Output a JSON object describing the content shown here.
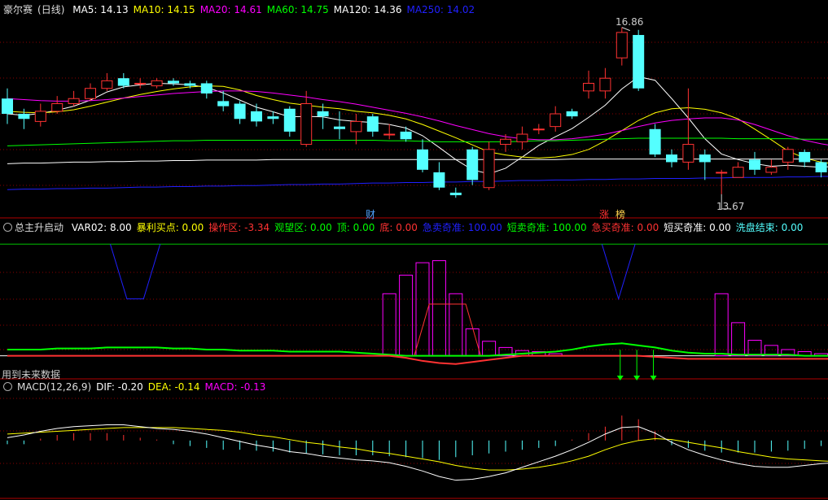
{
  "colors": {
    "up": "#ff3232",
    "down": "#54ffff",
    "ma5": "#ffffff",
    "ma10": "#ffff00",
    "ma20": "#ff00ff",
    "ma60": "#00ff00",
    "ma120": "#ffffff",
    "ma250": "#2020ff",
    "frame": "#b00000",
    "grid": "#8b0000"
  },
  "main_panel": {
    "stock_name": "豪尔赛",
    "period": "(日线)",
    "indicators": [
      {
        "label": "MA5: 14.13",
        "color": "#ffffff"
      },
      {
        "label": "MA10: 14.15",
        "color": "#ffff00"
      },
      {
        "label": "MA20: 14.61",
        "color": "#ff00ff"
      },
      {
        "label": "MA60: 14.75",
        "color": "#00ff00"
      },
      {
        "label": "MA120: 14.36",
        "color": "#ffffff"
      },
      {
        "label": "MA250: 14.02",
        "color": "#2020ff"
      }
    ],
    "high_label": "16.86",
    "low_label": "13.67",
    "event_tags": [
      {
        "text": "财",
        "color": "#4da3ff"
      },
      {
        "text": "涨",
        "color": "#ff3232"
      },
      {
        "text": "榜",
        "color": "#ffd24d"
      }
    ]
  },
  "indicator_panel": {
    "name": "总主升启动",
    "items": [
      {
        "label": "VAR02: 8.00",
        "color": "#ffffff"
      },
      {
        "label": "暴利买点: 0.00",
        "color": "#ffff00"
      },
      {
        "label": "操作区: -3.34",
        "color": "#ff3232"
      },
      {
        "label": "观望区: 0.00",
        "color": "#00ff00"
      },
      {
        "label": "顶: 0.00",
        "color": "#00ff00"
      },
      {
        "label": "底: 0.00",
        "color": "#ff3232"
      },
      {
        "label": "急卖奇准: 100.00",
        "color": "#2020ff"
      },
      {
        "label": "短卖奇准: 100.00",
        "color": "#00ff00"
      },
      {
        "label": "急买奇准: 0.00",
        "color": "#ff3232"
      },
      {
        "label": "短买奇准: 0.00",
        "color": "#ffffff"
      },
      {
        "label": "洗盘结束: 0.00",
        "color": "#54ffff"
      }
    ],
    "footer_note": "用到未来数据"
  },
  "macd_panel": {
    "items": [
      {
        "label": "MACD(12,26,9)",
        "color": "#dddddd"
      },
      {
        "label": "DIF: -0.20",
        "color": "#ffffff"
      },
      {
        "label": "DEA: -0.14",
        "color": "#ffff00"
      },
      {
        "label": "MACD: -0.13",
        "color": "#ff00ff"
      }
    ]
  },
  "chart_data": [
    {
      "type": "candlestick",
      "title": "豪尔赛(日线)",
      "ylim": [
        13.3,
        17.2
      ],
      "candles": [
        [
          15.55,
          15.25,
          15.75,
          15.05
        ],
        [
          15.25,
          15.15,
          15.35,
          14.95
        ],
        [
          15.1,
          15.3,
          15.45,
          15.0
        ],
        [
          15.3,
          15.45,
          15.6,
          15.25
        ],
        [
          15.45,
          15.55,
          15.7,
          15.4
        ],
        [
          15.55,
          15.75,
          15.85,
          15.5
        ],
        [
          15.75,
          15.9,
          16.05,
          15.7
        ],
        [
          15.95,
          15.8,
          16.05,
          15.75
        ],
        [
          15.85,
          15.85,
          15.95,
          15.75
        ],
        [
          15.8,
          15.9,
          15.95,
          15.75
        ],
        [
          15.9,
          15.85,
          15.95,
          15.8
        ],
        [
          15.85,
          15.8,
          15.9,
          15.75
        ],
        [
          15.85,
          15.65,
          15.9,
          15.55
        ],
        [
          15.5,
          15.4,
          15.7,
          15.3
        ],
        [
          15.45,
          15.15,
          15.5,
          15.05
        ],
        [
          15.3,
          15.1,
          15.45,
          15.0
        ],
        [
          15.2,
          15.15,
          15.3,
          15.05
        ],
        [
          15.35,
          14.9,
          15.4,
          14.8
        ],
        [
          14.65,
          15.45,
          15.7,
          14.6
        ],
        [
          15.3,
          15.2,
          15.45,
          14.95
        ],
        [
          15.0,
          14.95,
          15.3,
          14.75
        ],
        [
          14.9,
          15.1,
          15.25,
          14.65
        ],
        [
          15.2,
          14.9,
          15.25,
          14.8
        ],
        [
          14.85,
          14.85,
          15.05,
          14.75
        ],
        [
          14.9,
          14.75,
          15.0,
          14.7
        ],
        [
          14.55,
          14.15,
          14.75,
          14.1
        ],
        [
          14.1,
          13.8,
          14.3,
          13.75
        ],
        [
          13.7,
          13.65,
          13.8,
          13.6
        ],
        [
          14.55,
          13.95,
          14.6,
          13.85
        ],
        [
          13.8,
          14.55,
          14.7,
          13.75
        ],
        [
          14.65,
          14.75,
          14.85,
          14.5
        ],
        [
          14.7,
          14.85,
          15.0,
          14.55
        ],
        [
          14.95,
          14.95,
          15.05,
          14.85
        ],
        [
          15.0,
          15.25,
          15.4,
          14.9
        ],
        [
          15.3,
          15.2,
          15.35,
          15.15
        ],
        [
          15.7,
          15.85,
          16.1,
          15.55
        ],
        [
          15.7,
          15.95,
          16.15,
          15.55
        ],
        [
          16.35,
          16.85,
          16.95,
          16.2
        ],
        [
          16.8,
          15.75,
          16.9,
          15.7
        ],
        [
          14.95,
          14.45,
          15.05,
          14.4
        ],
        [
          14.45,
          14.3,
          14.55,
          14.2
        ],
        [
          14.3,
          14.65,
          15.75,
          14.15
        ],
        [
          14.45,
          14.3,
          14.55,
          13.95
        ],
        [
          14.1,
          14.1,
          14.15,
          13.67
        ],
        [
          14.0,
          14.2,
          14.3,
          14.0
        ],
        [
          14.35,
          14.15,
          14.5,
          14.05
        ],
        [
          14.1,
          14.2,
          14.35,
          14.05
        ],
        [
          14.3,
          14.55,
          14.6,
          14.15
        ],
        [
          14.5,
          14.3,
          14.55,
          14.2
        ],
        [
          14.3,
          14.1,
          14.35,
          14.0
        ],
        [
          14.05,
          14.15,
          14.25,
          13.95
        ]
      ],
      "ma_lines": [
        {
          "name": "MA5",
          "values": [
            15.25,
            15.22,
            15.26,
            15.32,
            15.4,
            15.52,
            15.68,
            15.78,
            15.82,
            15.85,
            15.84,
            15.82,
            15.77,
            15.66,
            15.52,
            15.38,
            15.29,
            15.19,
            15.2,
            15.19,
            15.13,
            15.1,
            15.08,
            15.04,
            14.97,
            14.82,
            14.59,
            14.35,
            14.15,
            14.07,
            14.18,
            14.4,
            14.63,
            14.8,
            14.96,
            15.18,
            15.42,
            15.74,
            15.98,
            15.91,
            15.55,
            15.17,
            14.76,
            14.46,
            14.35,
            14.27,
            14.22,
            14.24,
            14.22,
            14.2,
            14.22
          ]
        },
        {
          "name": "MA10",
          "values": [
            15.3,
            15.28,
            15.27,
            15.29,
            15.33,
            15.4,
            15.48,
            15.56,
            15.63,
            15.69,
            15.74,
            15.78,
            15.8,
            15.79,
            15.72,
            15.61,
            15.53,
            15.46,
            15.42,
            15.38,
            15.35,
            15.3,
            15.27,
            15.22,
            15.15,
            15.04,
            14.91,
            14.78,
            14.64,
            14.5,
            14.44,
            14.4,
            14.38,
            14.4,
            14.45,
            14.55,
            14.72,
            14.92,
            15.12,
            15.27,
            15.35,
            15.37,
            15.34,
            15.27,
            15.15,
            14.95,
            14.74,
            14.52,
            14.38,
            14.3,
            14.26
          ]
        },
        {
          "name": "MA20",
          "values": [
            15.55,
            15.53,
            15.51,
            15.5,
            15.5,
            15.51,
            15.53,
            15.56,
            15.59,
            15.62,
            15.65,
            15.67,
            15.69,
            15.7,
            15.7,
            15.69,
            15.66,
            15.62,
            15.58,
            15.53,
            15.49,
            15.44,
            15.38,
            15.32,
            15.26,
            15.19,
            15.11,
            15.02,
            14.94,
            14.86,
            14.8,
            14.76,
            14.74,
            14.74,
            14.76,
            14.8,
            14.85,
            14.92,
            15.0,
            15.07,
            15.12,
            15.15,
            15.17,
            15.17,
            15.13,
            15.04,
            14.93,
            14.82,
            14.73,
            14.66,
            14.61
          ]
        },
        {
          "name": "MA60",
          "values": [
            14.62,
            14.63,
            14.64,
            14.65,
            14.66,
            14.67,
            14.68,
            14.69,
            14.7,
            14.71,
            14.72,
            14.72,
            14.73,
            14.73,
            14.73,
            14.73,
            14.73,
            14.73,
            14.73,
            14.73,
            14.73,
            14.73,
            14.73,
            14.72,
            14.72,
            14.71,
            14.7,
            14.7,
            14.7,
            14.7,
            14.7,
            14.71,
            14.72,
            14.72,
            14.73,
            14.74,
            14.75,
            14.76,
            14.77,
            14.77,
            14.77,
            14.77,
            14.77,
            14.77,
            14.76,
            14.76,
            14.76,
            14.76,
            14.75,
            14.75,
            14.75
          ]
        },
        {
          "name": "MA120",
          "values": [
            14.27,
            14.28,
            14.28,
            14.29,
            14.3,
            14.3,
            14.31,
            14.31,
            14.32,
            14.32,
            14.33,
            14.33,
            14.34,
            14.34,
            14.34,
            14.34,
            14.35,
            14.35,
            14.35,
            14.35,
            14.35,
            14.35,
            14.35,
            14.35,
            14.35,
            14.35,
            14.35,
            14.35,
            14.35,
            14.35,
            14.35,
            14.35,
            14.35,
            14.35,
            14.36,
            14.36,
            14.36,
            14.36,
            14.36,
            14.36,
            14.36,
            14.36,
            14.36,
            14.36,
            14.36,
            14.36,
            14.36,
            14.36,
            14.36,
            14.36,
            14.36
          ]
        },
        {
          "name": "MA250",
          "values": [
            13.76,
            13.77,
            13.77,
            13.78,
            13.78,
            13.79,
            13.79,
            13.8,
            13.81,
            13.81,
            13.82,
            13.82,
            13.83,
            13.83,
            13.84,
            13.84,
            13.85,
            13.86,
            13.86,
            13.87,
            13.87,
            13.88,
            13.89,
            13.89,
            13.9,
            13.9,
            13.91,
            13.91,
            13.92,
            13.92,
            13.93,
            13.94,
            13.94,
            13.95,
            13.95,
            13.96,
            13.96,
            13.97,
            13.97,
            13.98,
            13.98,
            13.98,
            13.99,
            13.99,
            14.0,
            14.0,
            14.0,
            14.01,
            14.01,
            14.02,
            14.02
          ]
        }
      ]
    },
    {
      "type": "bar",
      "title": "总主升启动",
      "ylim": [
        -2,
        12
      ],
      "magenta_bars": [
        0,
        0,
        0,
        0,
        0,
        0,
        0,
        0,
        0,
        0,
        0,
        0,
        0,
        0,
        0,
        0,
        0,
        0,
        0,
        0,
        0,
        0,
        0,
        6,
        7.8,
        9,
        9.2,
        6,
        2.6,
        1.4,
        0.8,
        0.5,
        0.4,
        0.2,
        0,
        0,
        0,
        0,
        0,
        0,
        0,
        0,
        0,
        6,
        3.2,
        1.5,
        1.0,
        0.6,
        0.4,
        0.2,
        0
      ],
      "red_polygon": [
        [
          24.5,
          0
        ],
        [
          25.4,
          5.0
        ],
        [
          27.6,
          5.0
        ],
        [
          28.5,
          0
        ]
      ],
      "blue_v": [
        [
          [
            6.2,
            10.8
          ],
          [
            7.2,
            5.5
          ],
          [
            8.2,
            5.5
          ],
          [
            9.2,
            10.8
          ]
        ],
        [
          [
            35.8,
            10.8
          ],
          [
            36.8,
            5.5
          ],
          [
            37.8,
            10.8
          ]
        ]
      ],
      "green_line": [
        0.6,
        0.6,
        0.6,
        0.7,
        0.7,
        0.7,
        0.8,
        0.8,
        0.8,
        0.8,
        0.7,
        0.7,
        0.6,
        0.6,
        0.5,
        0.5,
        0.5,
        0.4,
        0.4,
        0.4,
        0.4,
        0.3,
        0.2,
        0.1,
        0,
        0,
        0,
        0,
        0,
        0,
        0.1,
        0.2,
        0.3,
        0.4,
        0.6,
        0.9,
        1.1,
        1.2,
        1.0,
        0.8,
        0.5,
        0.3,
        0.2,
        0.2,
        0.1,
        0.1,
        0.1,
        0.1,
        0,
        0,
        0
      ],
      "red_line": [
        0,
        0,
        0,
        0,
        0,
        0,
        0,
        0,
        0,
        0,
        0,
        0,
        0,
        0,
        0,
        0,
        0,
        0,
        0,
        0,
        0,
        0,
        0,
        0,
        -0.2,
        -0.5,
        -0.7,
        -0.8,
        -0.6,
        -0.4,
        -0.2,
        0,
        0,
        0,
        0,
        0,
        0,
        0,
        0,
        -0.1,
        -0.2,
        -0.3,
        -0.3,
        -0.3,
        -0.3,
        -0.3,
        -0.3,
        -0.3,
        -0.3,
        -0.3,
        -0.3
      ],
      "green_ticks": [
        36.9,
        37.9,
        38.9
      ],
      "hline": 10.8
    },
    {
      "type": "line",
      "title": "MACD(12,26,9)",
      "ylim": [
        -0.6,
        0.5
      ],
      "dif": [
        0.03,
        0.06,
        0.1,
        0.13,
        0.15,
        0.16,
        0.17,
        0.17,
        0.15,
        0.13,
        0.12,
        0.1,
        0.07,
        0.03,
        -0.01,
        -0.05,
        -0.08,
        -0.12,
        -0.14,
        -0.17,
        -0.19,
        -0.21,
        -0.22,
        -0.24,
        -0.28,
        -0.33,
        -0.39,
        -0.43,
        -0.42,
        -0.39,
        -0.35,
        -0.29,
        -0.23,
        -0.17,
        -0.1,
        -0.02,
        0.07,
        0.14,
        0.15,
        0.08,
        -0.02,
        -0.1,
        -0.16,
        -0.21,
        -0.25,
        -0.28,
        -0.29,
        -0.29,
        -0.27,
        -0.25,
        -0.24
      ],
      "dea": [
        0.07,
        0.08,
        0.09,
        0.1,
        0.11,
        0.12,
        0.13,
        0.14,
        0.14,
        0.14,
        0.14,
        0.13,
        0.12,
        0.11,
        0.09,
        0.06,
        0.04,
        0.01,
        -0.02,
        -0.04,
        -0.07,
        -0.09,
        -0.12,
        -0.14,
        -0.17,
        -0.2,
        -0.23,
        -0.27,
        -0.3,
        -0.32,
        -0.32,
        -0.31,
        -0.29,
        -0.26,
        -0.22,
        -0.17,
        -0.1,
        -0.04,
        0.0,
        0.02,
        0.01,
        -0.02,
        -0.05,
        -0.08,
        -0.12,
        -0.15,
        -0.18,
        -0.2,
        -0.21,
        -0.22,
        -0.23
      ],
      "hist": [
        -0.04,
        -0.04,
        0.02,
        0.06,
        0.08,
        0.08,
        0.08,
        0.06,
        0.03,
        0.01,
        -0.04,
        -0.06,
        -0.08,
        -0.1,
        -0.1,
        -0.11,
        -0.12,
        -0.13,
        -0.14,
        -0.15,
        -0.16,
        -0.16,
        -0.16,
        -0.17,
        -0.18,
        -0.19,
        -0.21,
        -0.18,
        -0.16,
        -0.14,
        -0.12,
        -0.1,
        -0.08,
        -0.06,
        0.01,
        0.08,
        0.15,
        0.27,
        0.23,
        0.1,
        -0.05,
        -0.08,
        -0.11,
        -0.13,
        -0.13,
        -0.13,
        -0.12,
        -0.11,
        -0.09,
        -0.06,
        -0.05
      ]
    }
  ]
}
